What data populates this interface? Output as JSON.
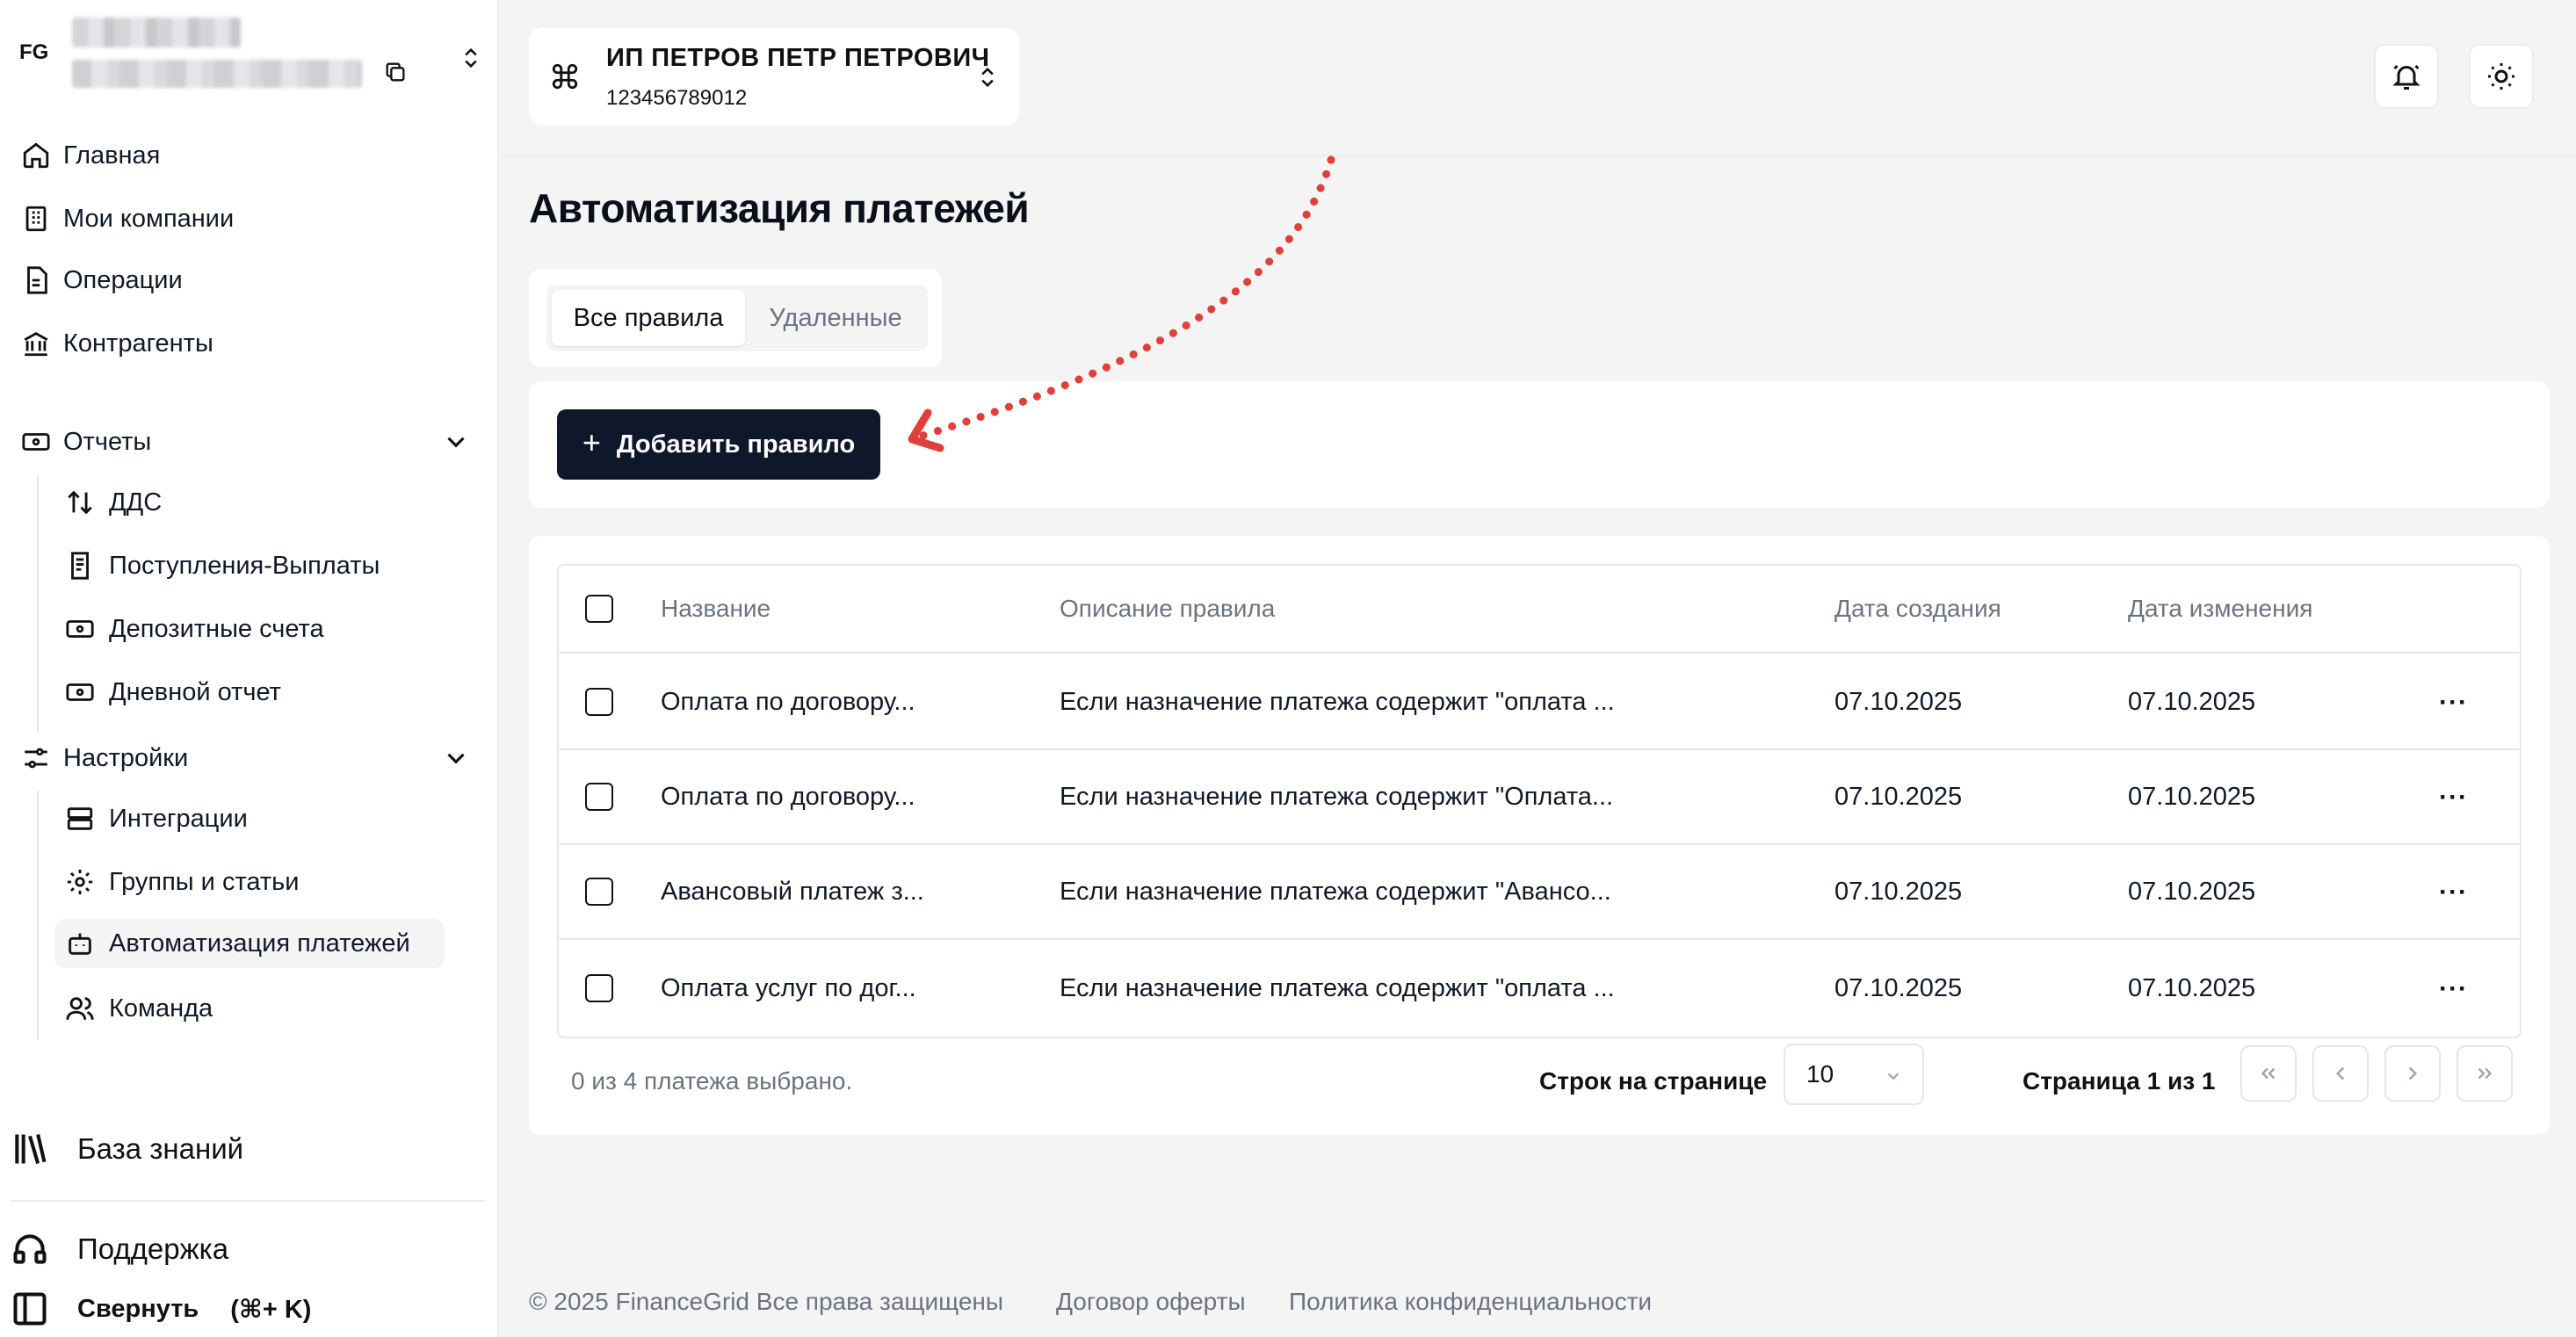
{
  "account": {
    "initials": "FG"
  },
  "nav": {
    "main": [
      {
        "label": "Главная",
        "icon": "home-icon"
      },
      {
        "label": "Мои компании",
        "icon": "building-icon"
      },
      {
        "label": "Операции",
        "icon": "document-icon"
      },
      {
        "label": "Контрагенты",
        "icon": "bank-icon"
      }
    ],
    "reports": {
      "label": "Отчеты",
      "items": [
        {
          "label": "ДДС",
          "icon": "arrows-updown-icon"
        },
        {
          "label": "Поступления-Выплаты",
          "icon": "receipt-icon"
        },
        {
          "label": "Депозитные счета",
          "icon": "banknote-icon"
        },
        {
          "label": "Дневной отчет",
          "icon": "banknote-icon"
        }
      ]
    },
    "settings": {
      "label": "Настройки",
      "items": [
        {
          "label": "Интеграции",
          "icon": "server-icon"
        },
        {
          "label": "Группы и статьи",
          "icon": "gear-icon"
        },
        {
          "label": "Автоматизация платежей",
          "icon": "robot-icon",
          "active": true
        },
        {
          "label": "Команда",
          "icon": "users-icon"
        }
      ]
    },
    "knowledge_base": "База знаний",
    "support": "Поддержка",
    "collapse": "Свернуть",
    "collapse_shortcut": "(⌘+ K)"
  },
  "company": {
    "name": "ИП ПЕТРОВ ПЕТР ПЕТРОВИЧ",
    "inn": "123456789012"
  },
  "page": {
    "title": "Автоматизация платежей",
    "tabs": [
      {
        "label": "Все правила",
        "active": true
      },
      {
        "label": "Удаленные",
        "active": false
      }
    ],
    "add_button": "Добавить правило"
  },
  "table": {
    "columns": [
      "Название",
      "Описание правила",
      "Дата создания",
      "Дата изменения"
    ],
    "rows": [
      {
        "name": "Оплата по договору...",
        "description": "Если назначение платежа содержит \"оплата ...",
        "created": "07.10.2025",
        "modified": "07.10.2025"
      },
      {
        "name": "Оплата по договору...",
        "description": "Если назначение платежа содержит \"Оплата...",
        "created": "07.10.2025",
        "modified": "07.10.2025"
      },
      {
        "name": "Авансовый платеж з...",
        "description": "Если назначение платежа содержит \"Авансо...",
        "created": "07.10.2025",
        "modified": "07.10.2025"
      },
      {
        "name": "Оплата услуг по дог...",
        "description": "Если назначение платежа содержит \"оплата ...",
        "created": "07.10.2025",
        "modified": "07.10.2025"
      }
    ],
    "more_label": "···"
  },
  "pagination": {
    "selected_info": "0 из 4 платежа выбрано.",
    "rows_per_page_label": "Строк на странице",
    "rows_per_page_value": "10",
    "page_info": "Страница 1 из 1"
  },
  "footer": {
    "copyright": "© 2025 FinanceGrid Все права защищены",
    "offer": "Договор оферты",
    "privacy": "Политика конфиденциальности"
  },
  "colors": {
    "primary": "#0f172a",
    "annotation_arrow": "#e0403a",
    "background": "#f4f4f5"
  }
}
